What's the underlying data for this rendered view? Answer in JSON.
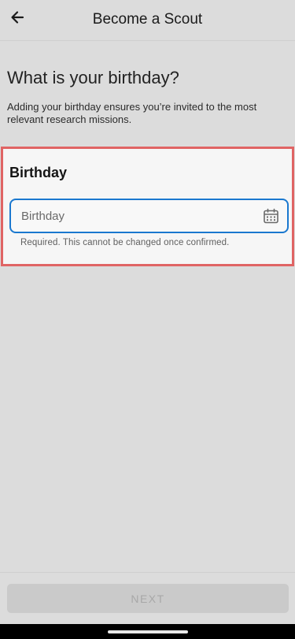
{
  "header": {
    "title": "Become a Scout",
    "back_icon": "arrow-left-icon"
  },
  "main": {
    "heading": "What is your birthday?",
    "subtitle": "Adding your birthday ensures you’re invited to the most relevant research missions."
  },
  "birthday_section": {
    "title": "Birthday",
    "input": {
      "placeholder": "Birthday",
      "value": "",
      "icon": "calendar-icon"
    },
    "helper_text": "Required. This cannot be changed once confirmed.",
    "highlight_color": "#e06464",
    "focus_color": "#1a78cf"
  },
  "footer": {
    "next_label": "NEXT",
    "next_enabled": false
  }
}
